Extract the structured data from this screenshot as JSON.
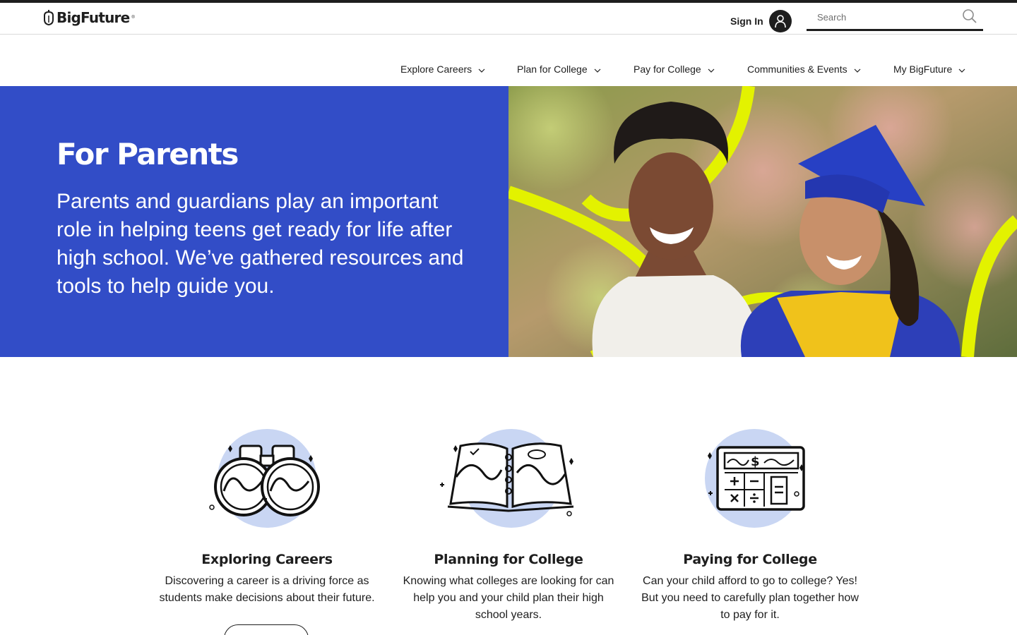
{
  "header": {
    "logo_text": "BigFuture",
    "logo_mark": "®",
    "sign_in_label": "Sign In",
    "search_placeholder": "Search"
  },
  "nav": {
    "items": [
      {
        "label": "Explore Careers"
      },
      {
        "label": "Plan for College"
      },
      {
        "label": "Pay for College"
      },
      {
        "label": "Communities & Events"
      },
      {
        "label": "My BigFuture"
      }
    ]
  },
  "hero": {
    "title": "For Parents",
    "description": "Parents and guardians play an important role in helping teens get ready for life after high school. We’ve gathered resources and tools to help guide you.",
    "image_icon": "mother-and-graduate-photo"
  },
  "cards": [
    {
      "icon": "binoculars-icon",
      "title": "Exploring Careers",
      "text": "Discovering a career is a driving force as students make decisions about their future."
    },
    {
      "icon": "map-book-icon",
      "title": "Planning for College",
      "text": "Knowing what colleges are looking for can help you and your child plan their high school years."
    },
    {
      "icon": "calculator-icon",
      "title": "Paying for College",
      "text": "Can your child afford to go to college? Yes! But you need to carefully plan together how to pay for it."
    }
  ],
  "colors": {
    "hero_blue": "#324dc7",
    "accent_yellow": "#e3f200",
    "icon_circle": "#c9d6f3",
    "text_dark": "#1e1e1e"
  }
}
